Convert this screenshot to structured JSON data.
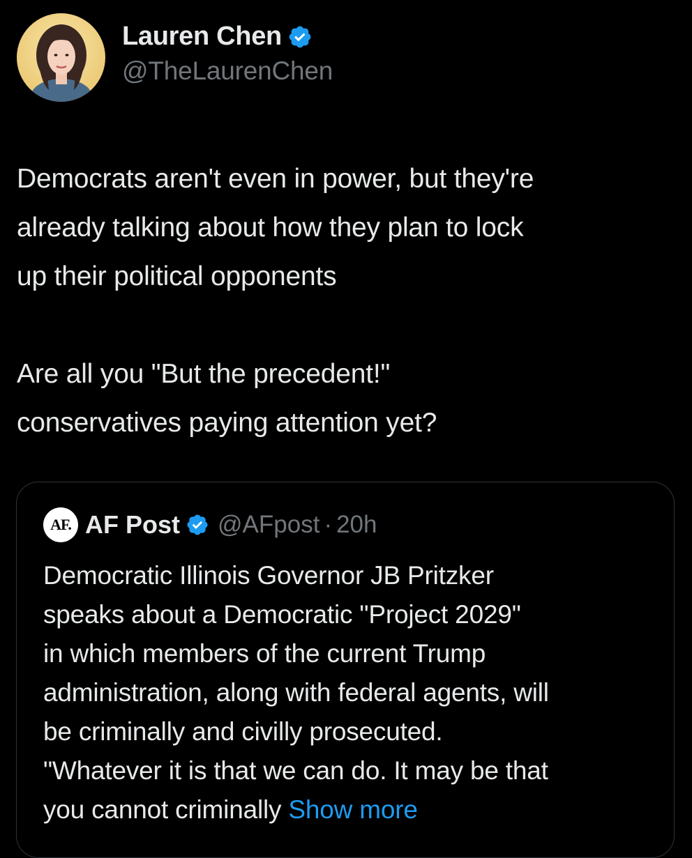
{
  "tweet": {
    "author": {
      "display_name": "Lauren Chen",
      "handle": "@TheLaurenChen",
      "verified_icon": "verified-badge-icon"
    },
    "paragraphs": [
      "Democrats aren't even in power, but they're\nalready talking about how they plan to lock\nup their political opponents",
      "Are all you \"But the precedent!\"\nconservatives paying attention yet?"
    ]
  },
  "quote": {
    "avatar_text": "AF.",
    "display_name": "AF Post",
    "handle": "@AFpost",
    "separator": "·",
    "time": "20h",
    "text": "Democratic Illinois Governor JB Pritzker\nspeaks about a Democratic \"Project 2029\"\nin which members of the current Trump\nadministration, along with federal agents, will\nbe criminally and civilly prosecuted.\n\"Whatever it is that we can do. It may be that\nyou cannot criminally ",
    "show_more": "Show more"
  },
  "colors": {
    "background": "#000000",
    "primary_text": "#e7e9ea",
    "secondary_text": "#71767b",
    "link": "#1d9bf0",
    "verified": "#1d9bf0",
    "border": "#2f3336"
  }
}
